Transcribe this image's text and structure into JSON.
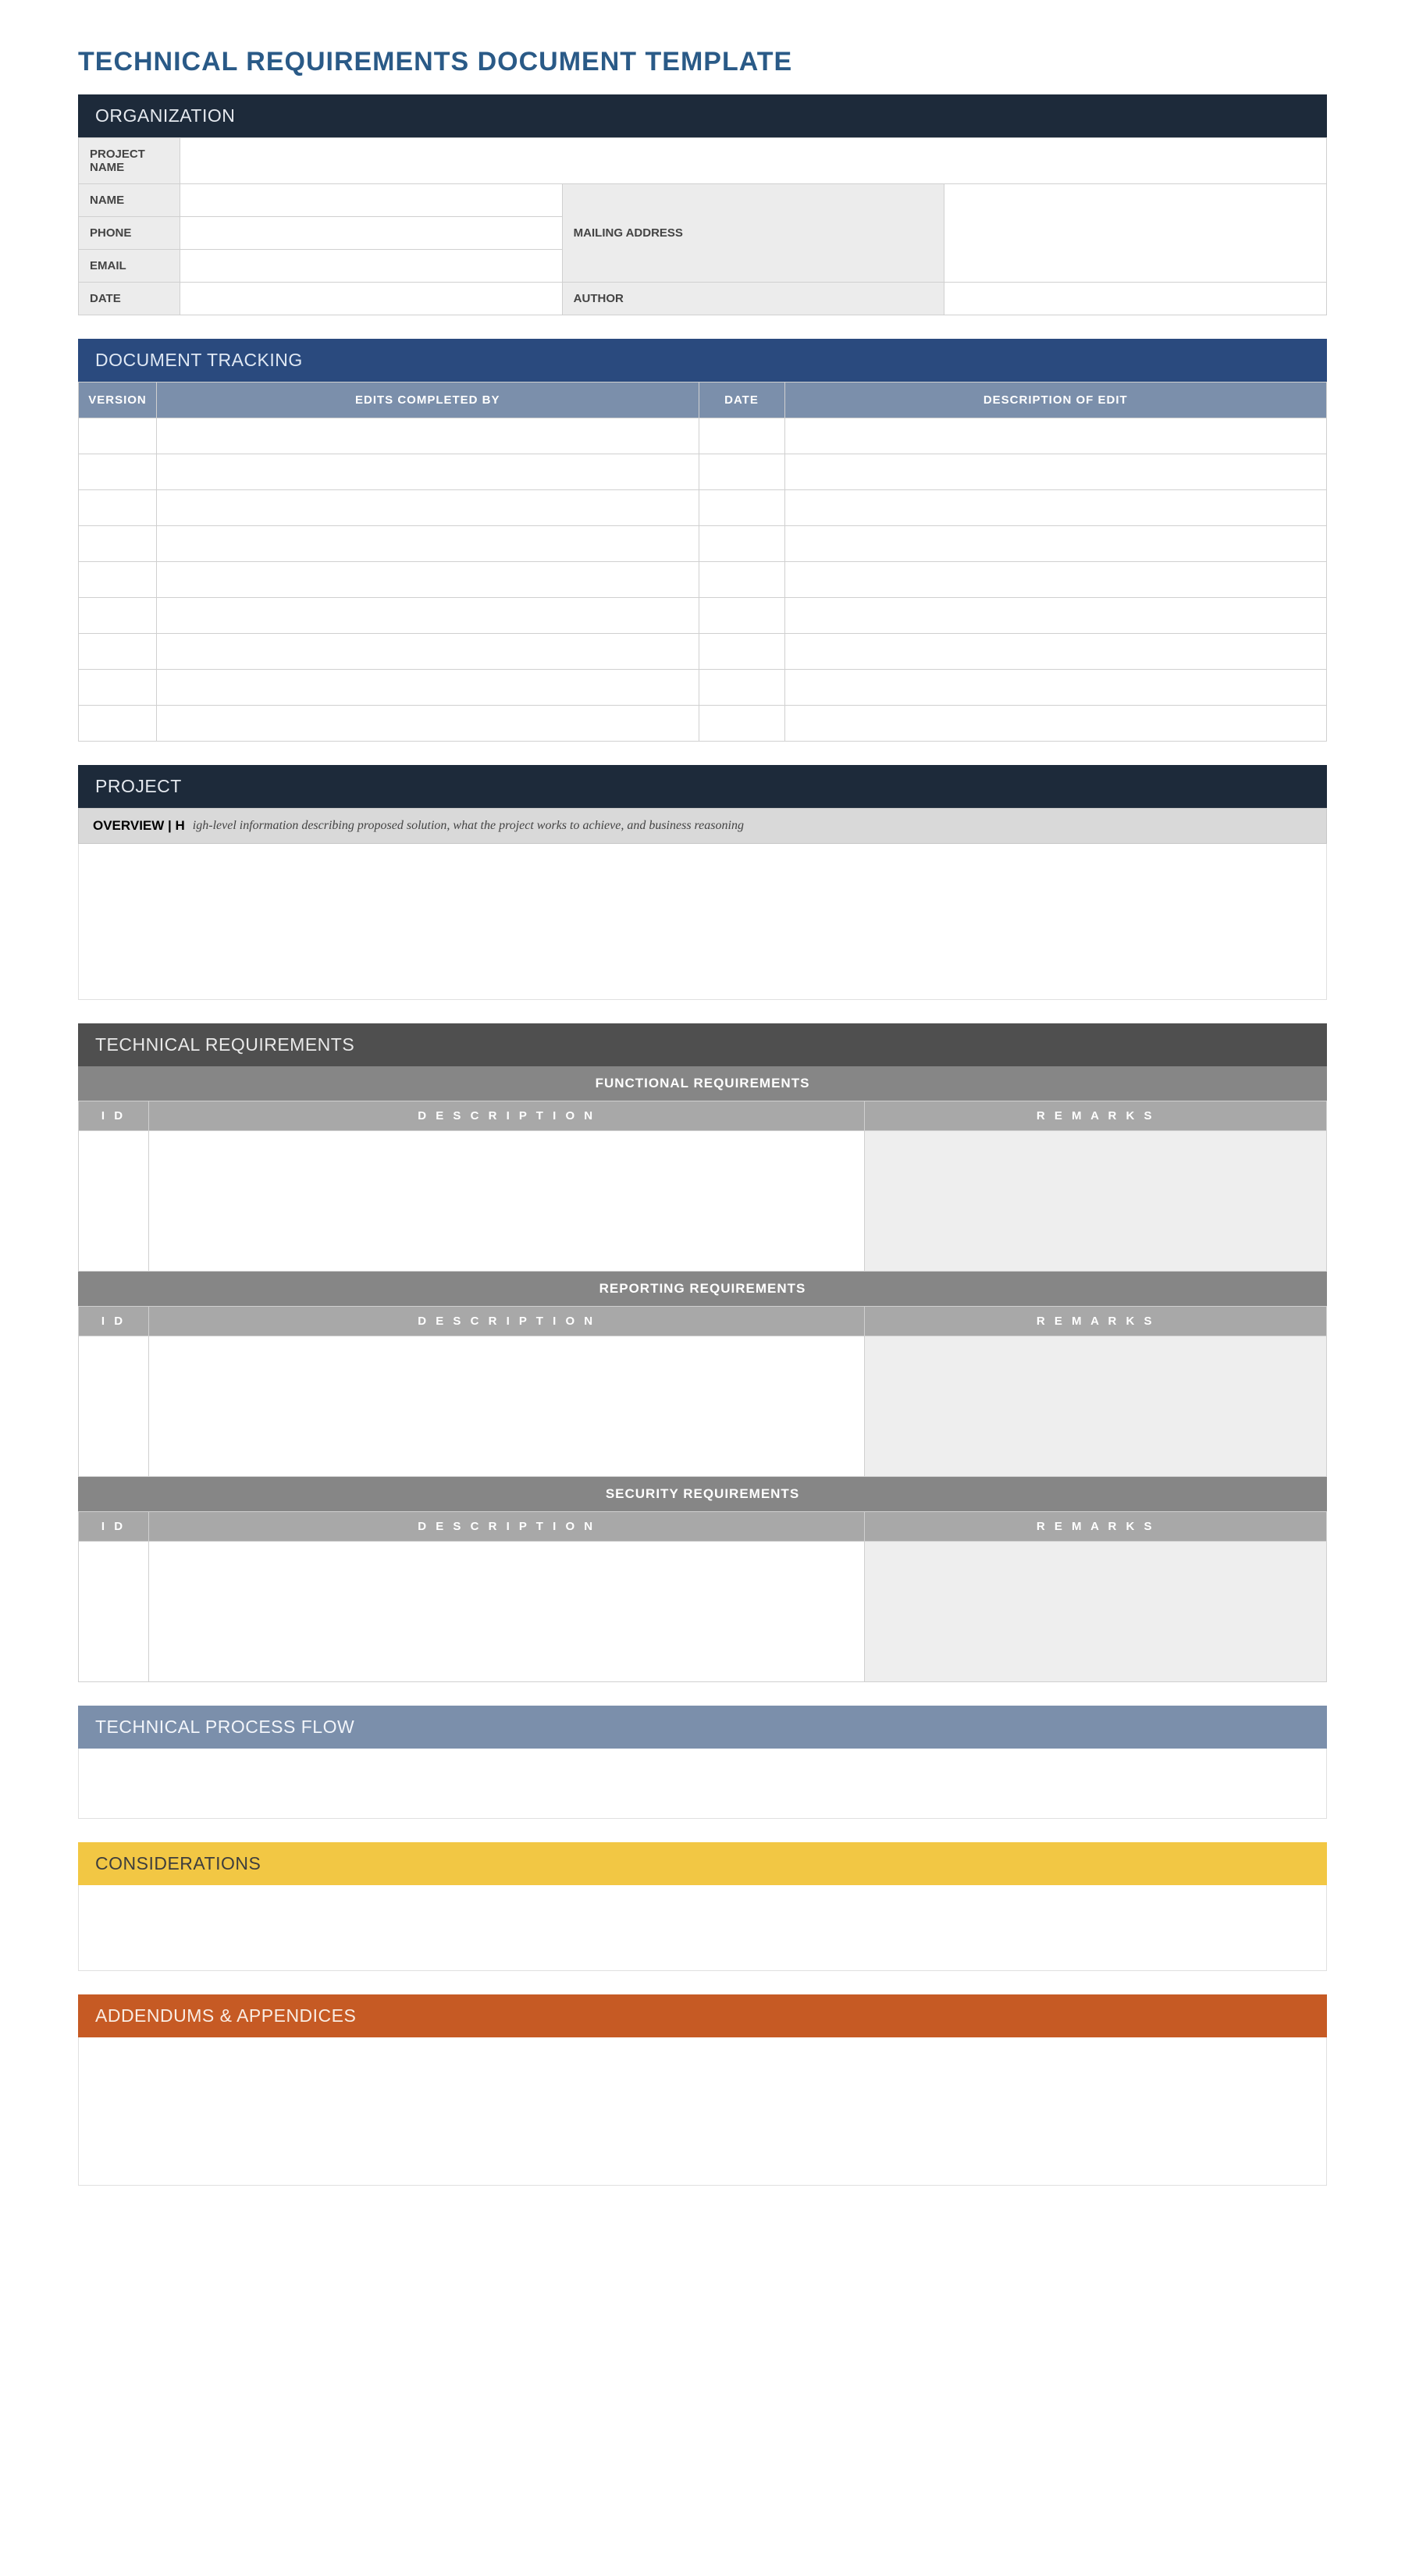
{
  "title": "TECHNICAL REQUIREMENTS DOCUMENT TEMPLATE",
  "organization": {
    "heading": "ORGANIZATION",
    "labels": {
      "project_name": "PROJECT NAME",
      "name": "NAME",
      "phone": "PHONE",
      "email": "EMAIL",
      "date": "DATE",
      "mailing_address": "MAILING ADDRESS",
      "author": "AUTHOR"
    },
    "values": {
      "project_name": "",
      "name": "",
      "phone": "",
      "email": "",
      "date": "",
      "mailing_address": "",
      "author": ""
    }
  },
  "tracking": {
    "heading": "DOCUMENT TRACKING",
    "columns": {
      "version": "VERSION",
      "edits_completed_by": "EDITS COMPLETED BY",
      "date": "DATE",
      "description": "DESCRIPTION OF EDIT"
    },
    "rows": [
      {
        "version": "",
        "edits_completed_by": "",
        "date": "",
        "description": ""
      },
      {
        "version": "",
        "edits_completed_by": "",
        "date": "",
        "description": ""
      },
      {
        "version": "",
        "edits_completed_by": "",
        "date": "",
        "description": ""
      },
      {
        "version": "",
        "edits_completed_by": "",
        "date": "",
        "description": ""
      },
      {
        "version": "",
        "edits_completed_by": "",
        "date": "",
        "description": ""
      },
      {
        "version": "",
        "edits_completed_by": "",
        "date": "",
        "description": ""
      },
      {
        "version": "",
        "edits_completed_by": "",
        "date": "",
        "description": ""
      },
      {
        "version": "",
        "edits_completed_by": "",
        "date": "",
        "description": ""
      },
      {
        "version": "",
        "edits_completed_by": "",
        "date": "",
        "description": ""
      }
    ]
  },
  "project": {
    "heading": "PROJECT",
    "overview_label": "OVERVIEW  |  H",
    "overview_desc": "igh-level information describing proposed solution, what the project works to achieve, and business reasoning",
    "overview_body": ""
  },
  "tech_req": {
    "heading": "TECHNICAL REQUIREMENTS",
    "columns": {
      "id": "I D",
      "description": "D E S C R I P T I O N",
      "remarks": "R E M A R K S"
    },
    "groups": [
      {
        "title": "FUNCTIONAL REQUIREMENTS",
        "rows": [
          {
            "id": "",
            "description": "",
            "remarks": ""
          }
        ]
      },
      {
        "title": "REPORTING REQUIREMENTS",
        "rows": [
          {
            "id": "",
            "description": "",
            "remarks": ""
          }
        ]
      },
      {
        "title": "SECURITY REQUIREMENTS",
        "rows": [
          {
            "id": "",
            "description": "",
            "remarks": ""
          }
        ]
      }
    ]
  },
  "process_flow": {
    "heading": "TECHNICAL PROCESS FLOW",
    "body": ""
  },
  "considerations": {
    "heading": "CONSIDERATIONS",
    "body": ""
  },
  "addendums": {
    "heading": "ADDENDUMS & APPENDICES",
    "body": ""
  }
}
